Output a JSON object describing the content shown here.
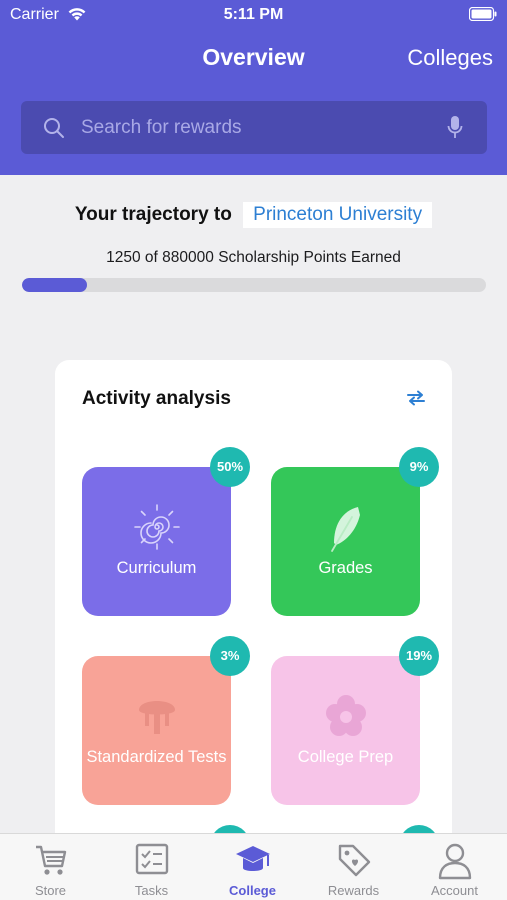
{
  "status_bar": {
    "carrier": "Carrier",
    "time": "5:11 PM"
  },
  "nav": {
    "title": "Overview",
    "right_label": "Colleges"
  },
  "search": {
    "placeholder": "Search for rewards",
    "value": ""
  },
  "trajectory": {
    "lead": "Your trajectory to",
    "college": "Princeton University",
    "points_text": "1250 of 880000 Scholarship Points Earned",
    "progress_fraction": 0.14
  },
  "activity": {
    "title": "Activity analysis",
    "tiles": [
      {
        "label": "Curriculum",
        "badge": "50%",
        "color": "#7b6de8",
        "icon": "sun-spiral-icon"
      },
      {
        "label": "Grades",
        "badge": "9%",
        "color": "#34c759",
        "icon": "feather-icon"
      },
      {
        "label": "Standardized Tests",
        "badge": "3%",
        "color": "#f8a397",
        "icon": "tree-icon"
      },
      {
        "label": "College Prep",
        "badge": "19%",
        "color": "#f7c4e8",
        "icon": "flower-icon"
      }
    ]
  },
  "tabs": [
    {
      "label": "Store",
      "icon": "cart-icon"
    },
    {
      "label": "Tasks",
      "icon": "checklist-icon"
    },
    {
      "label": "College",
      "icon": "graduation-cap-icon",
      "active": true
    },
    {
      "label": "Rewards",
      "icon": "tag-icon"
    },
    {
      "label": "Account",
      "icon": "person-icon"
    }
  ],
  "colors": {
    "primary": "#5b5bd6",
    "link": "#2d7fd3",
    "badge": "#1fb9b0",
    "background": "#efeff1"
  }
}
